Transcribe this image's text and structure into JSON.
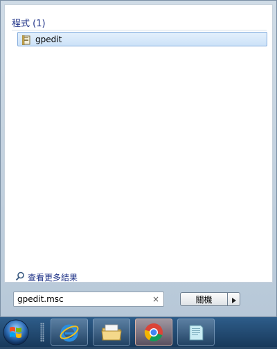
{
  "results": {
    "section_header": "程式 (1)",
    "items": [
      {
        "label": "gpedit",
        "icon": "group-policy-icon"
      }
    ]
  },
  "see_more": {
    "label": "查看更多結果",
    "icon": "search-icon"
  },
  "search": {
    "value": "gpedit.msc",
    "clear_glyph": "×"
  },
  "shutdown": {
    "label": "關機",
    "arrow_icon": "triangle-right-icon"
  },
  "taskbar": {
    "apps": [
      {
        "name": "internet-explorer",
        "icon": "internet-explorer-icon",
        "active": false
      },
      {
        "name": "windows-explorer",
        "icon": "folder-icon",
        "active": false
      },
      {
        "name": "chrome",
        "icon": "chrome-icon",
        "active": true
      },
      {
        "name": "notepad",
        "icon": "notepad-icon",
        "active": false
      }
    ]
  },
  "colors": {
    "header_text": "#1e3287",
    "highlight_border": "#84acdd",
    "taskbar_top": "#2e5d8a",
    "taskbar_bottom": "#18395b"
  }
}
